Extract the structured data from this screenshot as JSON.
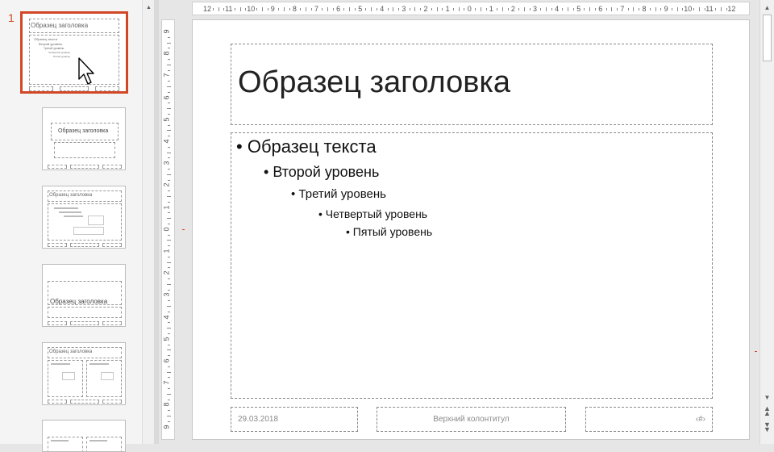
{
  "slide_number": "1",
  "master": {
    "title": "Образец заголовка",
    "levels": [
      "Образец текста",
      "Второй уровень",
      "Третий уровень",
      "Четвертый уровень",
      "Пятый уровень"
    ],
    "footer_date": "29.03.2018",
    "footer_text": "Верхний колонтитул",
    "footer_number": "‹#›"
  },
  "ruler_top": [
    "12",
    "11",
    "10",
    "9",
    "8",
    "7",
    "6",
    "5",
    "4",
    "3",
    "2",
    "1",
    "0",
    "1",
    "2",
    "3",
    "4",
    "5",
    "6",
    "7",
    "8",
    "9",
    "10",
    "11",
    "12"
  ],
  "ruler_left": [
    "9",
    "8",
    "7",
    "6",
    "5",
    "4",
    "3",
    "2",
    "1",
    "0",
    "1",
    "2",
    "3",
    "4",
    "5",
    "6",
    "7",
    "8",
    "9"
  ],
  "thumbs": {
    "layout1_title": "Образец заголовка",
    "layout2_title": "Образец заголовка",
    "layout3_title": "Образец заголовка",
    "layout4_title": "Образец заголовка",
    "layout5_title": "Образец заголовка"
  },
  "icons": {
    "scroll_up": "triangle-up-icon",
    "scroll_down": "triangle-down-icon",
    "prev_slide": "double-chevron-up-icon",
    "next_slide": "double-chevron-down-icon",
    "cursor": "arrow-cursor-icon"
  },
  "colors": {
    "accent": "#d24726"
  }
}
